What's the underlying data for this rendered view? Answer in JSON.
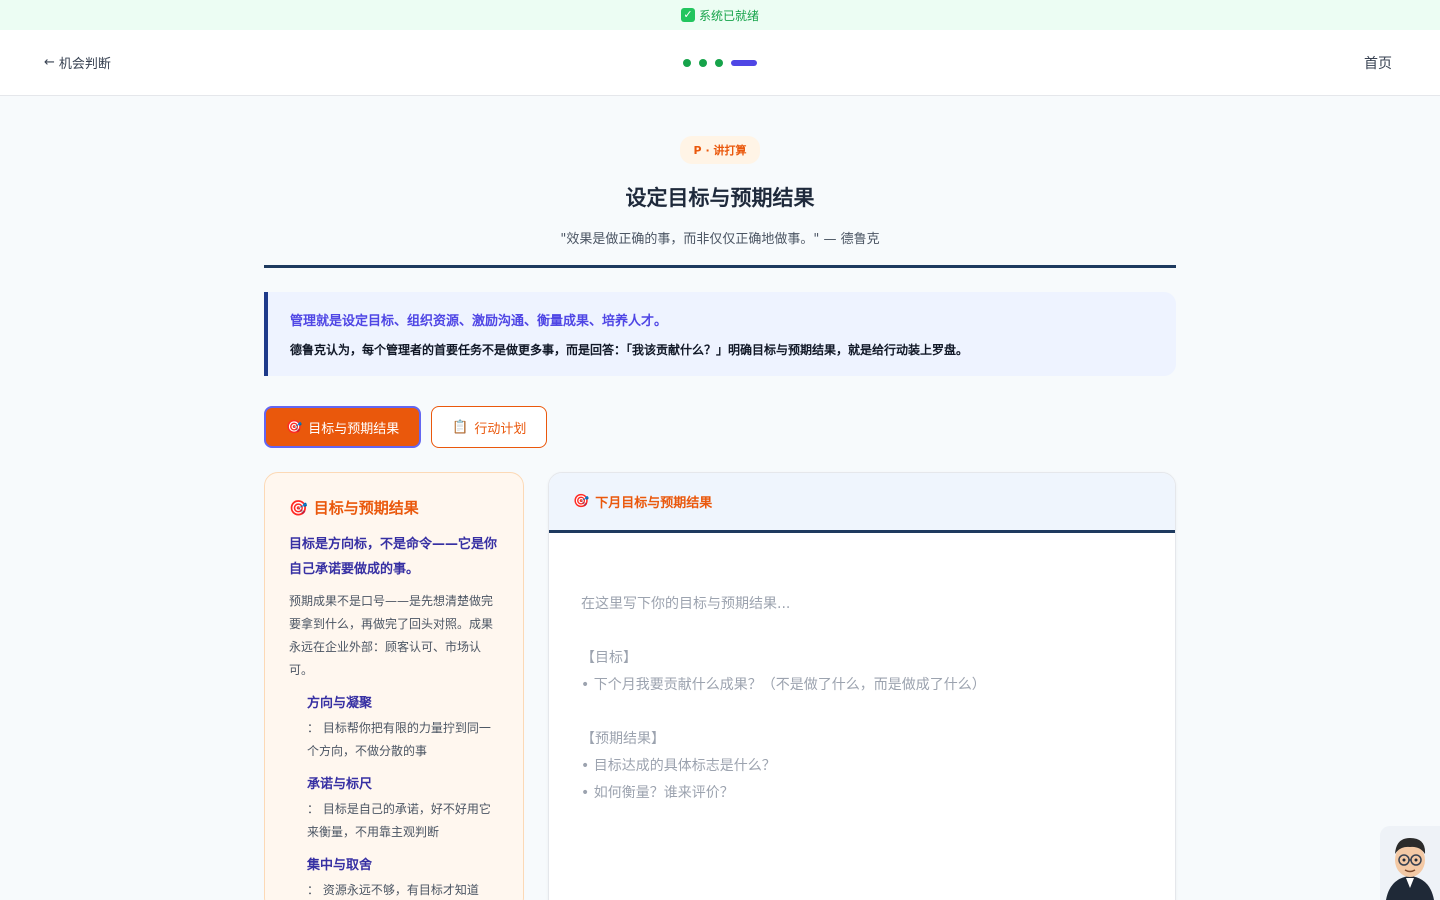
{
  "status": {
    "text": "系统已就绪"
  },
  "header": {
    "back_label": "机会判断",
    "home_label": "首页",
    "progress_steps": 4,
    "progress_current": 4
  },
  "hero": {
    "tag": "P · 讲打算",
    "title": "设定目标与预期结果",
    "quote": "\"效果是做正确的事，而非仅仅正确地做事。\" — 德鲁克"
  },
  "intro": {
    "line1": "管理就是设定目标、组织资源、激励沟通、衡量成果、培养人才。",
    "line2": "德鲁克认为，每个管理者的首要任务不是做更多事，而是回答：「我该贡献什么？」明确目标与预期结果，就是给行动装上罗盘。"
  },
  "tabs": [
    {
      "label": "目标与预期结果",
      "icon": "target-icon",
      "active": true
    },
    {
      "label": "行动计划",
      "icon": "clipboard-icon",
      "active": false
    }
  ],
  "guide": {
    "title": "目标与预期结果",
    "emphasis": "目标是方向标，不是命令——它是你自己承诺要做成的事。",
    "body": "预期成果不是口号——是先想清楚做完要拿到什么，再做完了回头对照。成果永远在企业外部：顾客认可、市场认可。",
    "points": [
      {
        "title": "方向与凝聚",
        "desc": "： 目标帮你把有限的力量拧到同一个方向，不做分散的事"
      },
      {
        "title": "承诺与标尺",
        "desc": "： 目标是自己的承诺，好不好用它来衡量，不用靠主观判断"
      },
      {
        "title": "集中与取舍",
        "desc": "： 资源永远不够，有目标才知道"
      }
    ]
  },
  "editor": {
    "title": "下月目标与预期结果",
    "placeholder_lines": [
      "在这里写下你的目标与预期结果...",
      "",
      "【目标】",
      "• 下个月我要贡献什么成果？（不是做了什么，而是做成了什么）",
      "",
      "【预期结果】",
      "• 目标达成的具体标志是什么？",
      "• 如何衡量？谁来评价？"
    ]
  }
}
